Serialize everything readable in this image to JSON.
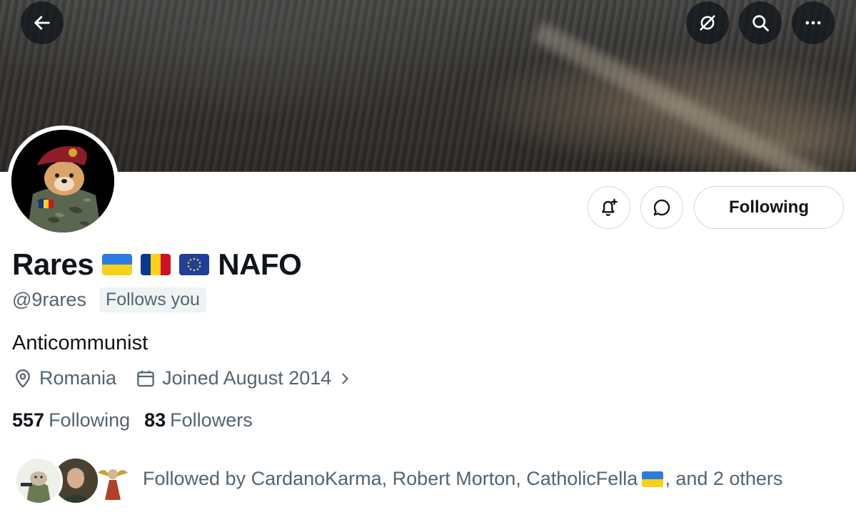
{
  "header": {
    "back_icon": "arrow-left-icon",
    "grok_icon": "grok-icon",
    "search_icon": "search-icon",
    "more_icon": "more-horizontal-icon"
  },
  "profile": {
    "display_name": "Rares",
    "name_suffix": "NAFO",
    "name_flags": [
      "ukraine-flag",
      "romania-flag",
      "eu-flag"
    ],
    "handle": "@9rares",
    "follows_you": "Follows you",
    "bio": "Anticommunist",
    "location": "Romania",
    "joined": "Joined August 2014",
    "following_count": "557",
    "following_label": "Following",
    "followers_count": "83",
    "followers_label": "Followers"
  },
  "actions": {
    "notify_icon": "bell-plus-icon",
    "message_icon": "message-icon",
    "following_button": "Following"
  },
  "mutuals": {
    "text_before_flag": "Followed by CardanoKarma, Robert Morton, CatholicFella",
    "text_after_flag": ", and 2 others"
  },
  "colors": {
    "text_primary": "#0f1419",
    "text_secondary": "#536471",
    "border": "#cfd9de",
    "badge_bg": "#eff3f4"
  }
}
